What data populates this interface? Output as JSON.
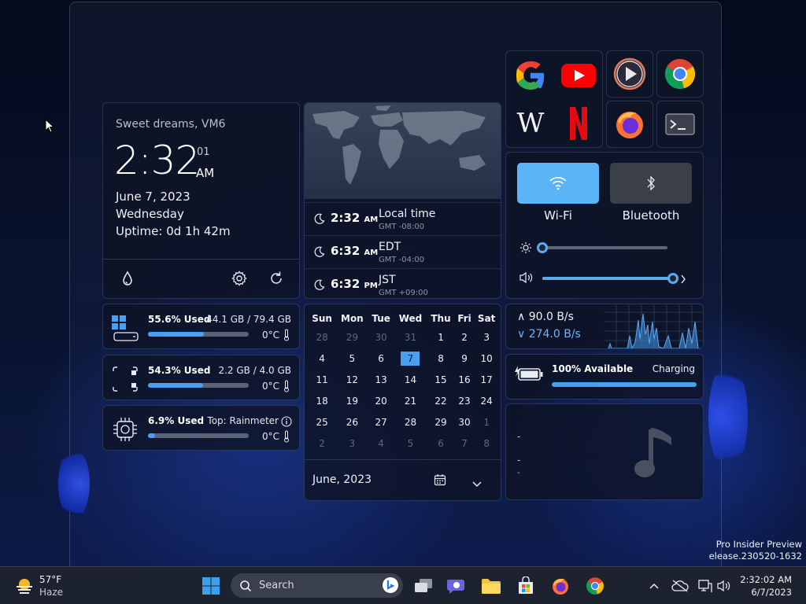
{
  "clock": {
    "greeting": "Sweet dreams, VM6",
    "time": "2:32",
    "seconds": "01",
    "ampm": "AM",
    "date": "June 7, 2023",
    "weekday": "Wednesday",
    "uptime": "Uptime: 0d 1h 42m",
    "icons": [
      "droplet-icon",
      "gear-icon",
      "refresh-icon"
    ]
  },
  "world": {
    "zones": [
      {
        "time": "2:32",
        "ampm": "AM",
        "name": "Local time",
        "offset": "GMT -08:00"
      },
      {
        "time": "6:32",
        "ampm": "AM",
        "name": "EDT",
        "offset": "GMT -04:00"
      },
      {
        "time": "6:32",
        "ampm": "PM",
        "name": "JST",
        "offset": "GMT +09:00"
      }
    ]
  },
  "apps": [
    "google-icon",
    "youtube-icon",
    "wikipedia-icon",
    "netflix-icon",
    "media-player-icon",
    "chrome-icon",
    "firefox-icon",
    "terminal-icon"
  ],
  "quick": {
    "wifi_label": "Wi-Fi",
    "bluetooth_label": "Bluetooth",
    "brightness": 0.0,
    "volume": 1.0,
    "accent": "#5ab4f5"
  },
  "storage": {
    "title": "55.6% Used",
    "right": "44.1 GB / 79.4 GB",
    "temp": "0°C",
    "percent": 55.6
  },
  "memory": {
    "title": "54.3% Used",
    "right": "2.2 GB / 4.0 GB",
    "temp": "0°C",
    "percent": 54.3
  },
  "cpu": {
    "title": "6.9% Used",
    "right": "Top: Rainmeter",
    "temp": "0°C",
    "percent": 6.9
  },
  "calendar": {
    "weekdays": [
      "Sun",
      "Mon",
      "Tue",
      "Wed",
      "Thu",
      "Fri",
      "Sat"
    ],
    "weeks": [
      [
        "28",
        "29",
        "30",
        "31",
        "1",
        "2",
        "3"
      ],
      [
        "4",
        "5",
        "6",
        "7",
        "8",
        "9",
        "10"
      ],
      [
        "11",
        "12",
        "13",
        "14",
        "15",
        "16",
        "17"
      ],
      [
        "18",
        "19",
        "20",
        "21",
        "22",
        "23",
        "24"
      ],
      [
        "25",
        "26",
        "27",
        "28",
        "29",
        "30",
        "1"
      ],
      [
        "2",
        "3",
        "4",
        "5",
        "6",
        "7",
        "8"
      ]
    ],
    "today": "7",
    "month_label": "June, 2023"
  },
  "network": {
    "up": "90.0 B/s",
    "down": "274.0 B/s"
  },
  "battery": {
    "status": "100% Available",
    "state": "Charging",
    "percent": 100
  },
  "media": {
    "lines": [
      "-",
      "-",
      "-"
    ]
  },
  "watermark": {
    "line1": "Pro Insider Preview",
    "line2": "elease.230520-1632"
  },
  "taskbar": {
    "weather_temp": "57°F",
    "weather_desc": "Haze",
    "search_label": "Search",
    "time": "2:32:02 AM",
    "date": "6/7/2023"
  }
}
